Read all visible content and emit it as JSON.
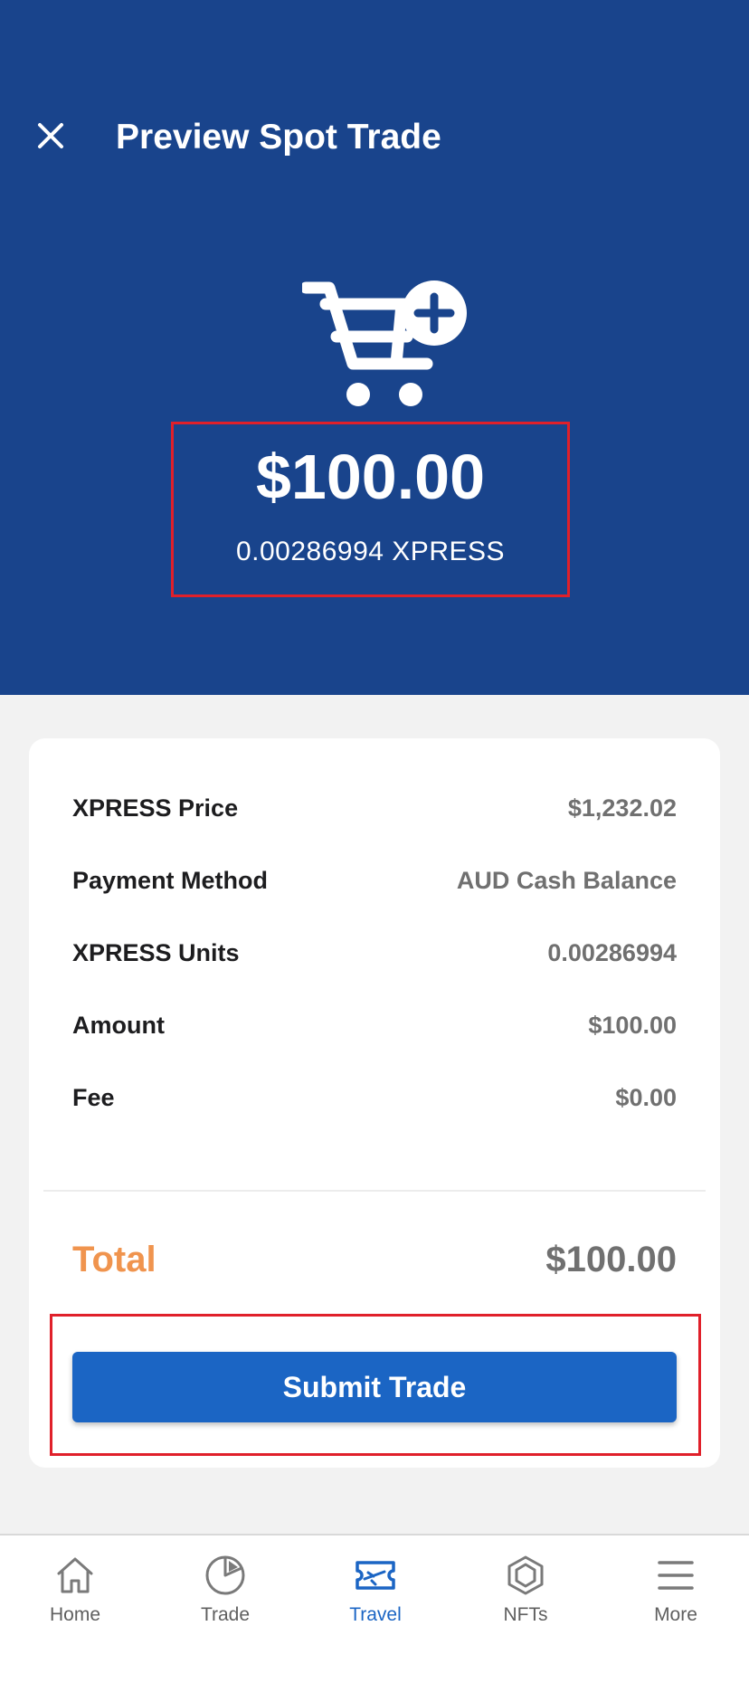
{
  "header": {
    "title": "Preview Spot Trade",
    "close_icon": "close-icon",
    "cart_icon": "cart-plus-icon"
  },
  "summary": {
    "amount_fiat": "$100.00",
    "amount_crypto": "0.00286994 XPRESS"
  },
  "details": {
    "rows": [
      {
        "label": "XPRESS Price",
        "value": "$1,232.02"
      },
      {
        "label": "Payment Method",
        "value": "AUD Cash Balance"
      },
      {
        "label": "XPRESS Units",
        "value": "0.00286994"
      },
      {
        "label": "Amount",
        "value": "$100.00"
      },
      {
        "label": "Fee",
        "value": "$0.00"
      }
    ],
    "total_label": "Total",
    "total_value": "$100.00"
  },
  "submit": {
    "label": "Submit Trade"
  },
  "nav": {
    "items": [
      {
        "label": "Home",
        "icon": "home-icon"
      },
      {
        "label": "Trade",
        "icon": "pie-chart-icon"
      },
      {
        "label": "Travel",
        "icon": "ticket-icon"
      },
      {
        "label": "NFTs",
        "icon": "hexagon-icon"
      },
      {
        "label": "More",
        "icon": "menu-icon"
      }
    ],
    "active": "Travel"
  },
  "colors": {
    "header_bg": "#19448c",
    "accent": "#1b65c4",
    "total": "#f0944e",
    "highlight": "#e0202a"
  }
}
